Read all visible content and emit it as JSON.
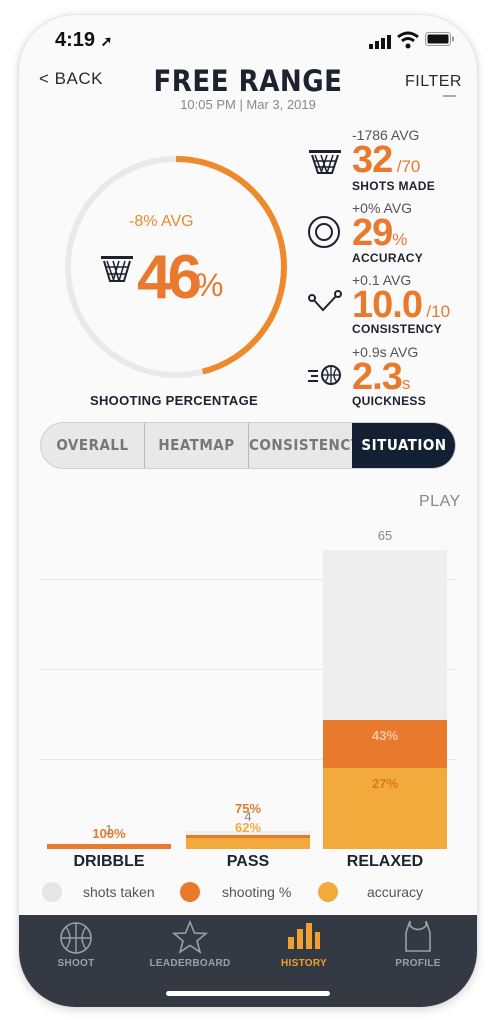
{
  "status": {
    "time": "4:19"
  },
  "nav": {
    "back": "< BACK",
    "title": "FREE RANGE",
    "subtitle": "10:05 PM | Mar 3, 2019",
    "filter": "FILTER"
  },
  "shooting": {
    "avg": "-8% AVG",
    "value": "46",
    "unit": "%",
    "label": "SHOOTING PERCENTAGE",
    "fraction": 0.46
  },
  "stats": [
    {
      "avg": "-1786 AVG",
      "value": "32",
      "denom": "/70",
      "label": "SHOTS MADE",
      "icon": "hoop-icon"
    },
    {
      "avg": "+0% AVG",
      "value": "29",
      "denom": "%",
      "label": "ACCURACY",
      "icon": "target-icon"
    },
    {
      "avg": "+0.1 AVG",
      "value": "10.0",
      "denom": "/10",
      "label": "CONSISTENCY",
      "icon": "arc-trajectory-icon"
    },
    {
      "avg": "+0.9s AVG",
      "value": "2.3",
      "denom": "s",
      "label": "QUICKNESS",
      "icon": "fast-ball-icon"
    }
  ],
  "tabs": [
    "OVERALL",
    "HEATMAP",
    "CONSISTENCY",
    "SITUATION"
  ],
  "active_tab": 3,
  "chart_header": "PLAY",
  "chart_data": {
    "type": "bar",
    "categories": [
      "DRIBBLE",
      "PASS",
      "RELAXED"
    ],
    "series": [
      {
        "name": "shots taken",
        "values": [
          1,
          4,
          65
        ]
      },
      {
        "name": "shooting %",
        "values": [
          100,
          75,
          43
        ]
      },
      {
        "name": "accuracy",
        "values": [
          null,
          62,
          27
        ]
      }
    ],
    "ylim": [
      0,
      65
    ]
  },
  "colors": {
    "shots": "#eeeeee",
    "shooting": "#e8792d",
    "accuracy": "#f2aa3c",
    "accent": "#e8792d",
    "dark": "#132033"
  },
  "legend": [
    "shots taken",
    "shooting %",
    "accuracy"
  ],
  "tabbar": [
    {
      "label": "SHOOT",
      "icon": "basketball-icon"
    },
    {
      "label": "LEADERBOARD",
      "icon": "star-icon"
    },
    {
      "label": "HISTORY",
      "icon": "bar-chart-icon"
    },
    {
      "label": "PROFILE",
      "icon": "jersey-icon"
    }
  ],
  "active_tabbar": 2
}
